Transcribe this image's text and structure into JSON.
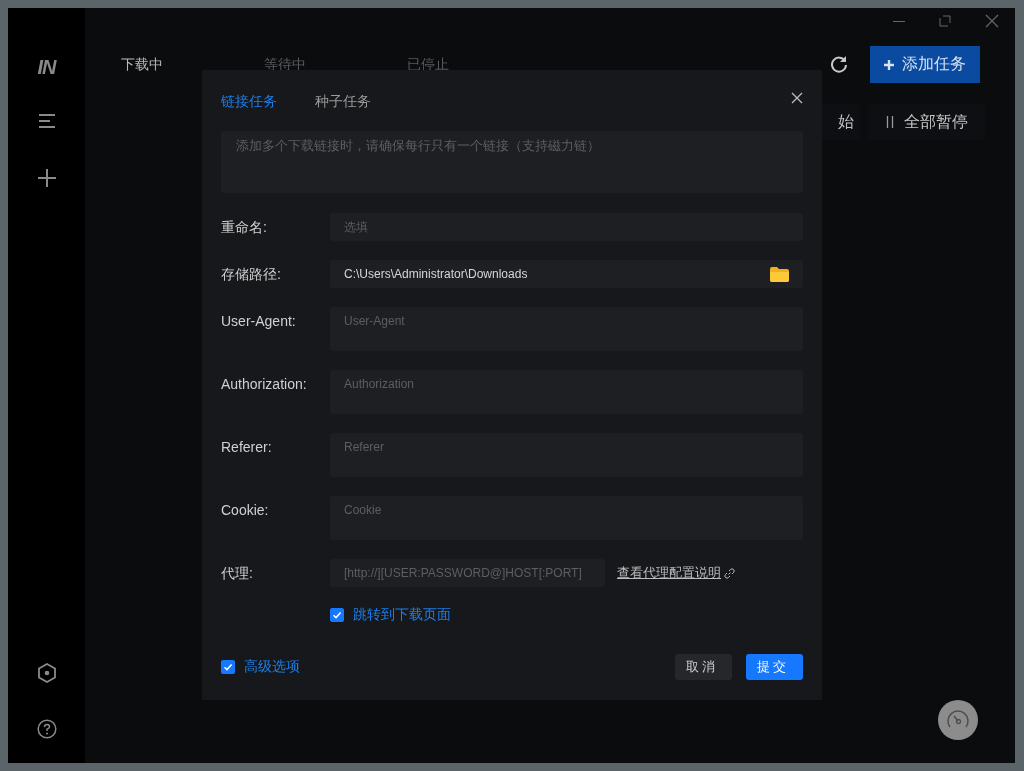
{
  "sidebar": {
    "logo": "IN"
  },
  "tabs": [
    {
      "label": "下载中",
      "selected": true
    },
    {
      "label": "等待中",
      "selected": false
    },
    {
      "label": "已停止",
      "selected": false
    }
  ],
  "toolbar": {
    "add_button": "添加任务",
    "start_button": "始",
    "pause_all_button": "全部暂停"
  },
  "dialog": {
    "tabs": [
      {
        "label": "链接任务",
        "selected": true
      },
      {
        "label": "种子任务",
        "selected": false
      }
    ],
    "links_field": {
      "placeholder": "添加多个下载链接时，请确保每行只有一个链接（支持磁力链）"
    },
    "fields": [
      {
        "kind": "single",
        "label": "重命名:",
        "placeholder": "选填"
      },
      {
        "kind": "folder",
        "label": "存储路径:",
        "value": "C:\\Users\\Administrator\\Downloads"
      },
      {
        "kind": "multi",
        "label": "User-Agent:",
        "placeholder": "User-Agent"
      },
      {
        "kind": "multi",
        "label": "Authorization:",
        "placeholder": "Authorization"
      },
      {
        "kind": "multi",
        "label": "Referer:",
        "placeholder": "Referer"
      },
      {
        "kind": "multi",
        "label": "Cookie:",
        "placeholder": "Cookie"
      },
      {
        "kind": "proxy",
        "label": "代理:",
        "placeholder": "[http://][USER:PASSWORD@]HOST[:PORT]",
        "link": "查看代理配置说明"
      }
    ],
    "jump_checkbox": {
      "label": "跳转到下载页面",
      "checked": true
    },
    "advanced_checkbox": {
      "label": "高级选项",
      "checked": true
    },
    "buttons": [
      "取消",
      "提交"
    ]
  }
}
